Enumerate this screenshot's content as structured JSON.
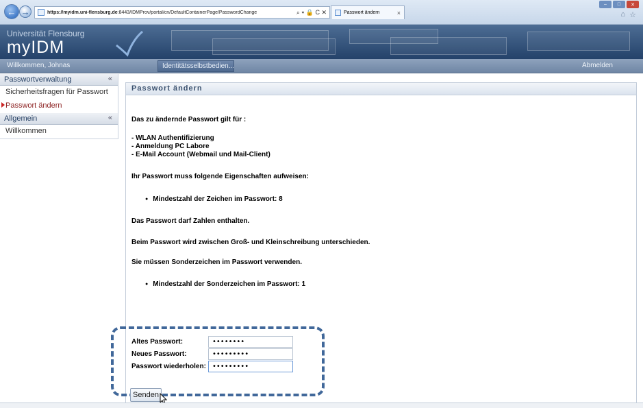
{
  "browser": {
    "url_host": "https://myidm.uni-flensburg.de",
    "url_path": ":8443/IDMProv/portal/cn/DefaultContainerPage/PasswordChange",
    "address_tools": "⌕ ▾ 🔒 C ✕",
    "tab_title": "Passwort ändern",
    "tab_close": "×",
    "back_glyph": "←",
    "forward_glyph": "→",
    "win_min": "–",
    "win_max": "□",
    "win_close": "✕",
    "home_glyph": "⌂",
    "star_glyph": "☆"
  },
  "header": {
    "university": "Universität Flensburg",
    "app_name": "myIDM"
  },
  "navbar": {
    "welcome": "Willkommen, Johnas",
    "active_tab": "Identitätsselbstbedien...",
    "logout": "Abmelden"
  },
  "sidebar": {
    "groups": [
      {
        "title": "Passwortverwaltung",
        "collapse_glyph": "«",
        "items": [
          {
            "label": "Sicherheitsfragen für Passwort"
          },
          {
            "label": "Passwort ändern"
          }
        ]
      },
      {
        "title": "Allgemein",
        "collapse_glyph": "«",
        "items": [
          {
            "label": "Willkommen"
          }
        ]
      }
    ]
  },
  "main": {
    "title": "Passwort ändern",
    "intro": "Das zu ändernde Passwort gilt für :",
    "services": [
      "- WLAN Authentifizierung",
      "- Anmeldung PC Labore",
      "- E-Mail Account (Webmail und Mail-Client)"
    ],
    "requirements_heading": "Ihr Passwort muss folgende Eigenschaften aufweisen:",
    "min_length": "Mindestzahl der Zeichen im Passwort: 8",
    "digits_note": "Das Passwort darf Zahlen enthalten.",
    "case_note": "Beim Passwort wird zwischen Groß- und Kleinschreibung unterschieden.",
    "special_note": "Sie müssen Sonderzeichen im Passwort verwenden.",
    "min_special": "Mindestzahl der Sonderzeichen im Passwort: 1"
  },
  "form": {
    "old_label": "Altes Passwort:",
    "old_value": "••••••••",
    "new_label": "Neues Passwort:",
    "new_value": "•••••••••",
    "repeat_label": "Passwort wiederholen:",
    "repeat_value": "•••••••••",
    "submit": "Senden"
  },
  "colors": {
    "header_bg": "#24426a",
    "highlight_dash": "#41689a",
    "active_item": "#8b1f1f"
  }
}
